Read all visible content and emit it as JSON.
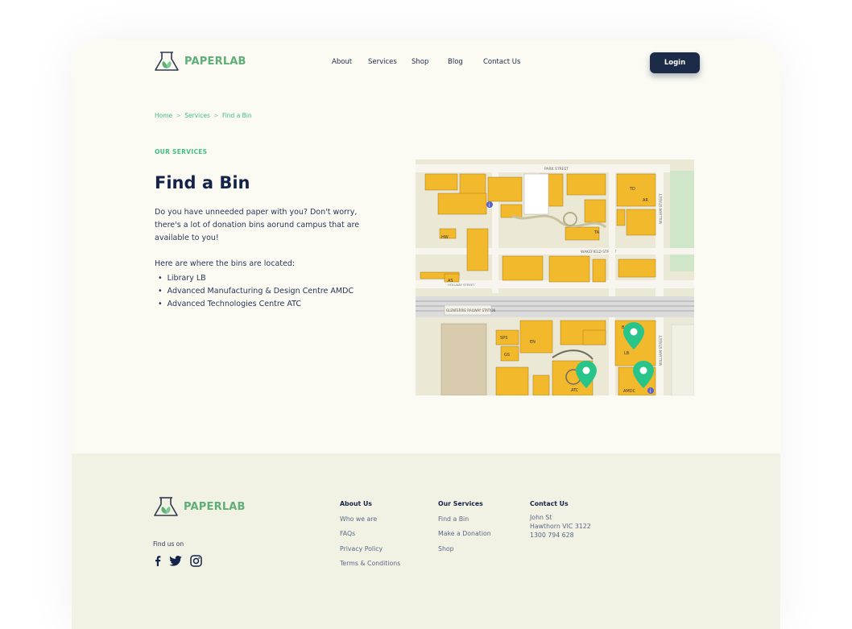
{
  "brand": {
    "name": "PAPERLAB",
    "logo_color": "#5fae77"
  },
  "nav": {
    "items": [
      "About",
      "Services",
      "Shop",
      "Blog",
      "Contact Us"
    ],
    "login": "Login"
  },
  "breadcrumb": {
    "home": "Home",
    "sep": ">",
    "services": "Services",
    "current": "Find a Bin"
  },
  "hero": {
    "eyebrow": "OUR SERVICES",
    "title": "Find a Bin",
    "intro": "Do you have unneeded paper with you? Don't worry, there's a lot of donation bins aorund campus that are available to you!",
    "bins_heading": "Here are where the bins are located:",
    "bins": [
      "Library LB",
      "Advanced Manufacturing & Design Centre AMDC",
      "Advanced Technologies Centre ATC"
    ]
  },
  "map": {
    "streets": {
      "park": "PARK STREET",
      "wakefield": "WAKEFIELD STREET",
      "william": "WILLIAM STREET",
      "railway": "GLENFERRIE RAILWAY STATION",
      "hollway": "HOLLWAY STREET"
    },
    "labels": [
      "LB",
      "ATC",
      "AMDC",
      "EN",
      "SPS",
      "GS",
      "BA",
      "TD",
      "AR",
      "TA",
      "AS",
      "HW"
    ],
    "marker_color": "#28c48a",
    "building_color": "#f2b92d",
    "street_color": "#f7f5ee"
  },
  "footer": {
    "find_us": "Find us on",
    "social_icons": [
      "facebook-icon",
      "twitter-icon",
      "instagram-icon"
    ],
    "about": {
      "heading": "About Us",
      "links": [
        "Who we are",
        "FAQs",
        "Privacy Policy",
        "Terms & Conditions"
      ]
    },
    "services": {
      "heading": "Our Services",
      "links": [
        "Find a Bin",
        "Make a Donation",
        "Shop"
      ]
    },
    "contact": {
      "heading": "Contact Us",
      "lines": [
        "John St",
        "Hawthorn VIC 3122",
        "1300 794 628"
      ]
    }
  },
  "colors": {
    "accent": "#3fbf7f",
    "navy": "#1b2b48",
    "page_bg": "#fbfbf4",
    "footer_bg": "#f1f2e4"
  }
}
